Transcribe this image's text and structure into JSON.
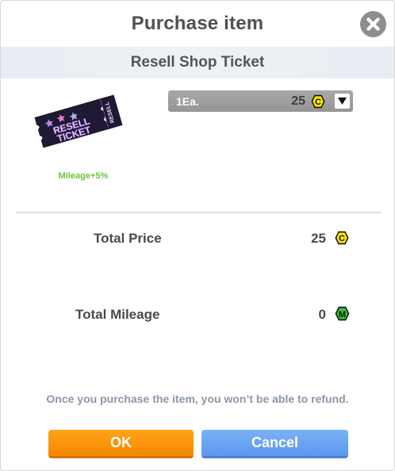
{
  "dialog": {
    "title": "Purchase item",
    "close_icon": "close-icon"
  },
  "item": {
    "name": "Resell Shop Ticket",
    "ticket_line1": "RESELL",
    "ticket_line2": "TICKET",
    "ticket_side_text": "RESELL",
    "mileage_bonus": "Mileage+5%"
  },
  "quantity_select": {
    "selected_label": "1Ea.",
    "price": "25",
    "currency_icon": "coin-c-icon",
    "currency_glyph": "C",
    "dropdown_icon": "triangle-down-icon"
  },
  "totals": {
    "price_label": "Total Price",
    "price_value": "25",
    "price_icon": "coin-c-icon",
    "price_glyph": "C",
    "mileage_label": "Total Mileage",
    "mileage_value": "0",
    "mileage_icon": "mileage-m-icon",
    "mileage_glyph": "M"
  },
  "notice": "Once you purchase the item, you won’t be able to refund.",
  "buttons": {
    "ok": "OK",
    "cancel": "Cancel"
  },
  "colors": {
    "ok": "#f59200",
    "cancel": "#6aa6f4",
    "mileage_text": "#6cc43a",
    "coin_yellow": "#ffe600",
    "mileage_green": "#34c13c",
    "ticket_dark": "#1f1933"
  }
}
